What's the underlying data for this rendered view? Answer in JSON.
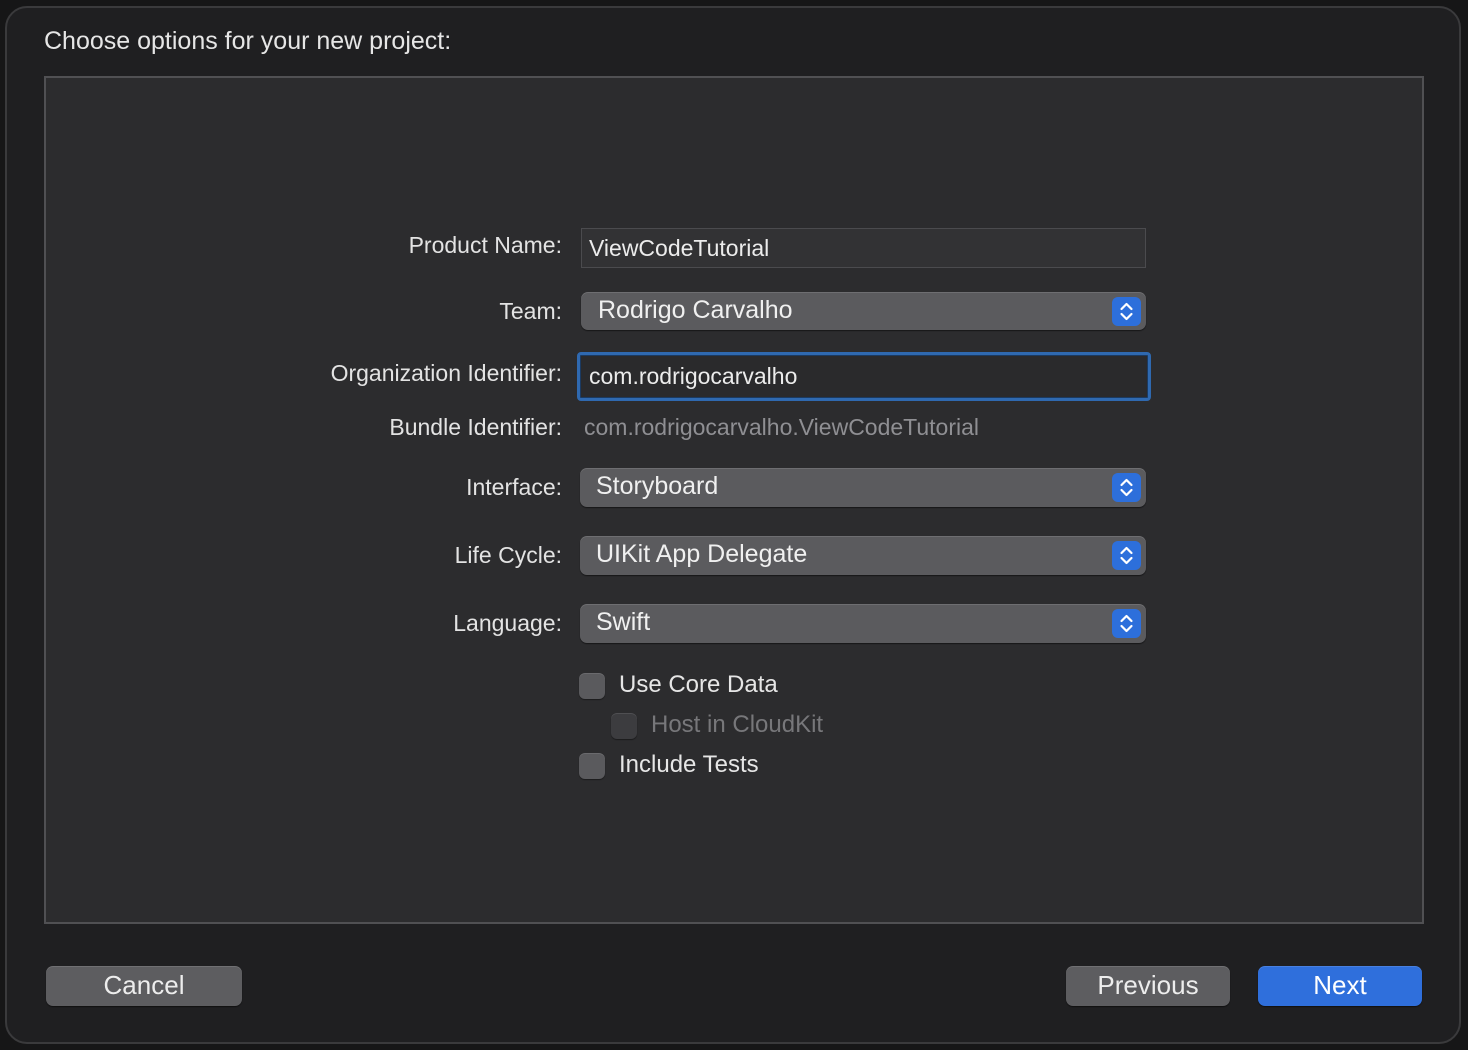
{
  "dialog": {
    "title": "Choose options for your new project:"
  },
  "form": {
    "product_name": {
      "label": "Product Name:",
      "value": "ViewCodeTutorial"
    },
    "team": {
      "label": "Team:",
      "value": "Rodrigo Carvalho"
    },
    "organization_identifier": {
      "label": "Organization Identifier:",
      "value": "com.rodrigocarvalho"
    },
    "bundle_identifier": {
      "label": "Bundle Identifier:",
      "value": "com.rodrigocarvalho.ViewCodeTutorial"
    },
    "interface": {
      "label": "Interface:",
      "value": "Storyboard"
    },
    "life_cycle": {
      "label": "Life Cycle:",
      "value": "UIKit App Delegate"
    },
    "language": {
      "label": "Language:",
      "value": "Swift"
    },
    "options": {
      "use_core_data": {
        "label": "Use Core Data",
        "checked": false,
        "enabled": true
      },
      "host_in_cloudkit": {
        "label": "Host in CloudKit",
        "checked": false,
        "enabled": false
      },
      "include_tests": {
        "label": "Include Tests",
        "checked": false,
        "enabled": true
      }
    }
  },
  "buttons": {
    "cancel": "Cancel",
    "previous": "Previous",
    "next": "Next"
  },
  "colors": {
    "accent": "#2f6fdc",
    "focus_ring": "#2f69b0",
    "window_background": "#1f1f21",
    "panel_background": "#2c2c2e"
  },
  "icons": {
    "popup_indicator": "chevron-up-down-icon"
  }
}
